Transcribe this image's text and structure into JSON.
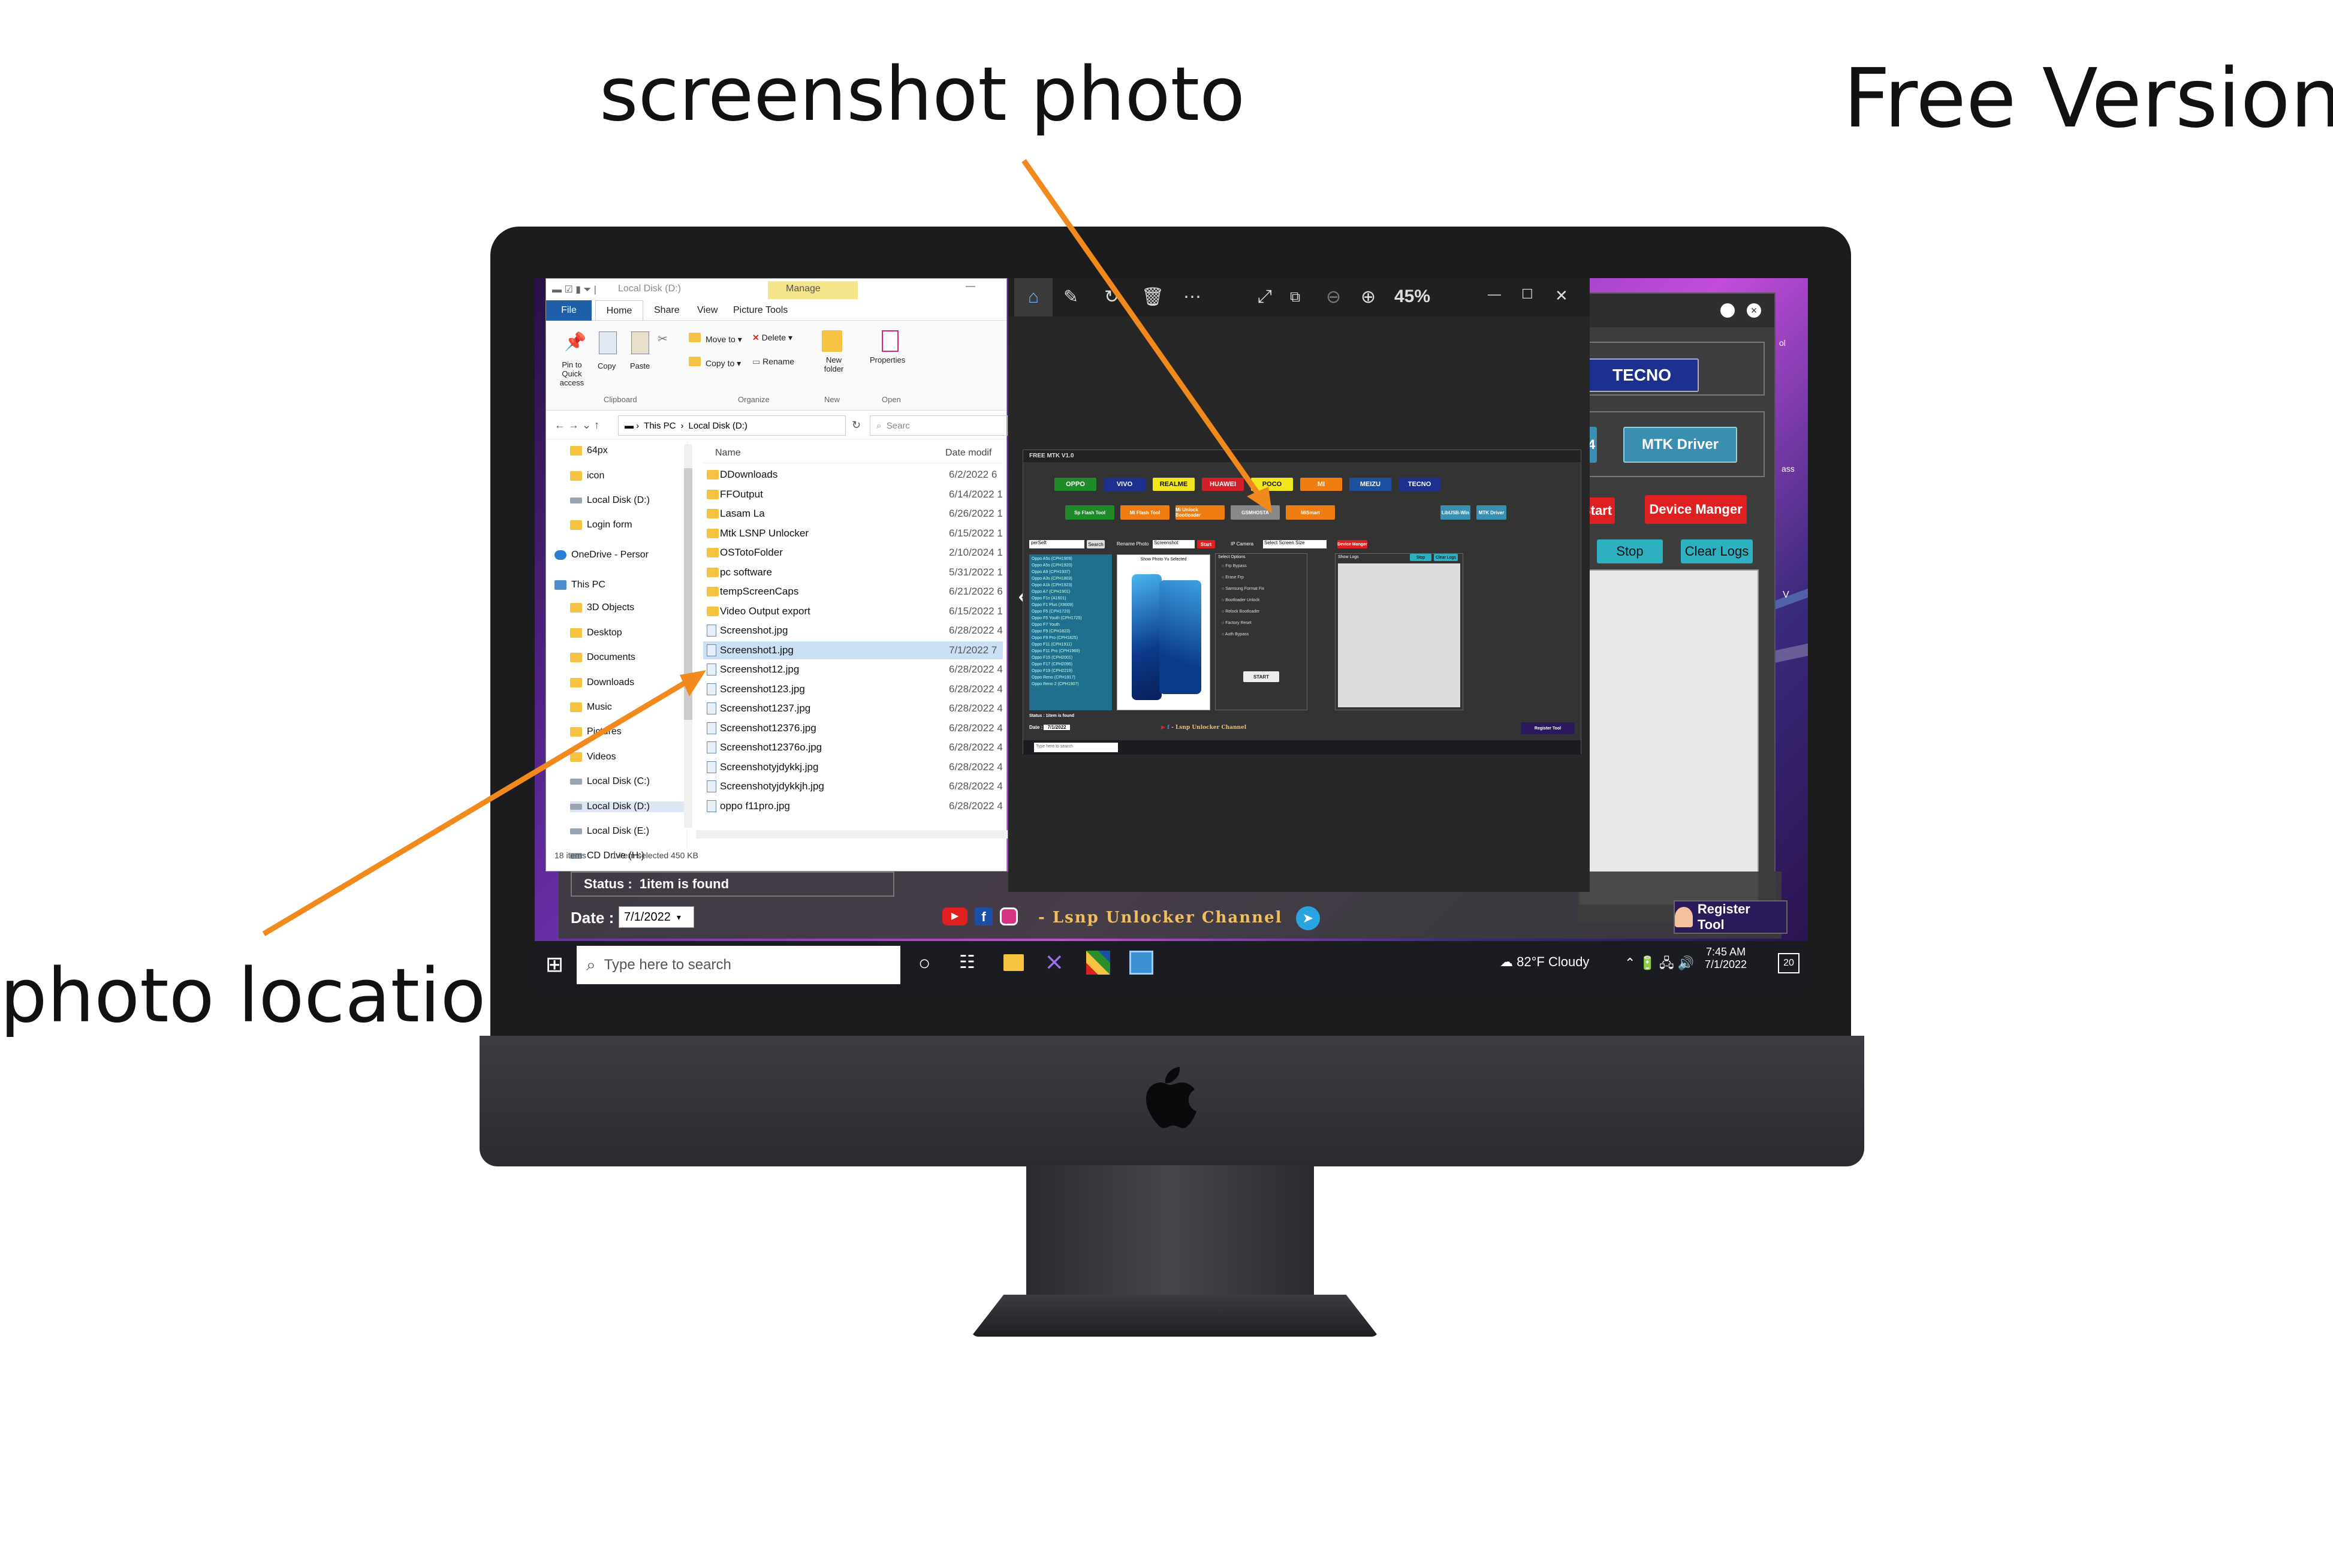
{
  "annotations": {
    "screenshot_photo": "screenshot photo",
    "free_version": "Free Version",
    "photo_location": "photo location"
  },
  "explorer": {
    "title": "Local Disk (D:)",
    "manage_tab": "Manage",
    "tabs": [
      "File",
      "Home",
      "Share",
      "View",
      "Picture Tools"
    ],
    "ribbon": {
      "pin": "Pin to Quick access",
      "copy": "Copy",
      "paste": "Paste",
      "move_to": "Move to",
      "copy_to": "Copy to",
      "delete": "Delete",
      "rename": "Rename",
      "new_folder": "New folder",
      "properties": "Properties",
      "group_clipboard": "Clipboard",
      "group_organize": "Organize",
      "group_new": "New",
      "group_open": "Open"
    },
    "breadcrumb": [
      "This PC",
      "Local Disk (D:)"
    ],
    "search_placeholder": "Searc",
    "col_name": "Name",
    "col_date": "Date modif",
    "nav": [
      {
        "label": "64px",
        "type": "folder"
      },
      {
        "label": "icon",
        "type": "folder"
      },
      {
        "label": "Local Disk (D:)",
        "type": "drive"
      },
      {
        "label": "Login form",
        "type": "folder"
      },
      {
        "label": "OneDrive - Persor",
        "type": "cloud"
      },
      {
        "label": "This PC",
        "type": "pc"
      },
      {
        "label": "3D Objects",
        "type": "folder"
      },
      {
        "label": "Desktop",
        "type": "folder"
      },
      {
        "label": "Documents",
        "type": "folder"
      },
      {
        "label": "Downloads",
        "type": "folder"
      },
      {
        "label": "Music",
        "type": "folder"
      },
      {
        "label": "Pictures",
        "type": "folder"
      },
      {
        "label": "Videos",
        "type": "folder"
      },
      {
        "label": "Local Disk (C:)",
        "type": "drive"
      },
      {
        "label": "Local Disk (D:)",
        "type": "drive"
      },
      {
        "label": "Local Disk (E:)",
        "type": "drive"
      },
      {
        "label": "CD Drive (H:)",
        "type": "drive"
      }
    ],
    "files": [
      {
        "name": "DDownloads",
        "date": "6/2/2022 6",
        "type": "folder"
      },
      {
        "name": "FFOutput",
        "date": "6/14/2022 1",
        "type": "folder"
      },
      {
        "name": "Lasam La",
        "date": "6/26/2022 1",
        "type": "folder"
      },
      {
        "name": "Mtk LSNP Unlocker",
        "date": "6/15/2022 1",
        "type": "folder"
      },
      {
        "name": "OSTotoFolder",
        "date": "2/10/2024 1",
        "type": "folder"
      },
      {
        "name": "pc software",
        "date": "5/31/2022 1",
        "type": "folder"
      },
      {
        "name": "tempScreenCaps",
        "date": "6/21/2022 6",
        "type": "folder"
      },
      {
        "name": "Video Output export",
        "date": "6/15/2022 1",
        "type": "folder"
      },
      {
        "name": "Screenshot.jpg",
        "date": "6/28/2022 4",
        "type": "image"
      },
      {
        "name": "Screenshot1.jpg",
        "date": "7/1/2022 7",
        "type": "image"
      },
      {
        "name": "Screenshot12.jpg",
        "date": "6/28/2022 4",
        "type": "image"
      },
      {
        "name": "Screenshot123.jpg",
        "date": "6/28/2022 4",
        "type": "image"
      },
      {
        "name": "Screenshot1237.jpg",
        "date": "6/28/2022 4",
        "type": "image"
      },
      {
        "name": "Screenshot12376.jpg",
        "date": "6/28/2022 4",
        "type": "image"
      },
      {
        "name": "Screenshot12376o.jpg",
        "date": "6/28/2022 4",
        "type": "image"
      },
      {
        "name": "Screenshotyjdykkj.jpg",
        "date": "6/28/2022 4",
        "type": "image"
      },
      {
        "name": "Screenshotyjdykkjh.jpg",
        "date": "6/28/2022 4",
        "type": "image"
      },
      {
        "name": "oppo f11pro.jpg",
        "date": "6/28/2022 4",
        "type": "image"
      }
    ],
    "selected_index": 9,
    "status_items": "18 items",
    "status_selected": "1 item selected  450 KB"
  },
  "photos": {
    "zoom": "45%"
  },
  "inner_tool": {
    "title": "FREE MTK V1.0",
    "brands": [
      {
        "label": "OPPO",
        "color": "#1f8a2a",
        "text": "#ffffff"
      },
      {
        "label": "VIVO",
        "color": "#1d2f8f",
        "text": "#ffffff"
      },
      {
        "label": "REALME",
        "color": "#f2e61c",
        "text": "#111111"
      },
      {
        "label": "HUAWEI",
        "color": "#d41f2a",
        "text": "#ffffff"
      },
      {
        "label": "POCO",
        "color": "#f2e61c",
        "text": "#111111"
      },
      {
        "label": "MI",
        "color": "#f07d12",
        "text": "#ffffff"
      },
      {
        "label": "MEIZU",
        "color": "#1d4fa0",
        "text": "#ffffff"
      },
      {
        "label": "TECNO",
        "color": "#1d2f8f",
        "text": "#ffffff"
      }
    ],
    "tools": [
      {
        "label": "Sp Flash Tool",
        "color": "#1f8a2a"
      },
      {
        "label": "Mi Flash Tool",
        "color": "#f07d12"
      },
      {
        "label": "Mi Unlock Bootloader",
        "color": "#f07d12"
      },
      {
        "label": "GSMHOSTA",
        "color": "#888888"
      },
      {
        "label": "MiSmart",
        "color": "#f07d12"
      }
    ],
    "drivers": [
      "LibUSB-Win",
      "MTK Driver"
    ],
    "search_value": "perSeft",
    "search_btn": "Search",
    "rename_label": "Rename Photo",
    "rename_value": "Screenshot",
    "start_btn": "Start",
    "camera_label": "IP Camera",
    "camera_value": "Select Screen Size",
    "device_btn": "Device Manger",
    "model_list": [
      "Oppo A5s (CPH1909)",
      "Oppo A5s (CPH1920)",
      "Oppo A9 (CPH1937)",
      "Oppo A3s (CPH1803)",
      "Oppo A1k (CPH1923)",
      "Oppo A7 (CPH1901)",
      "Oppo F1s (A1601)",
      "Oppo F1 Plus (X9009)",
      "Oppo F5 (CPH1723)",
      "Oppo F5 Youth (CPH1725)",
      "Oppo F7 Youth",
      "Oppo F9 (CPH1823)",
      "Oppo F9 Pro (CPH1825)",
      "Oppo F11 (CPH1911)",
      "Oppo F11 Pro (CPH1969)",
      "Oppo F15 (CPH2001)",
      "Oppo F17 (CPH2095)",
      "Oppo F19 (CPH2219)",
      "Oppo Reno (CPH1917)",
      "Oppo Reno 2 (CPH1907)"
    ],
    "preview_label": "Show Photo Yu Selected",
    "options_title": "Select Options",
    "options": [
      "Frp Bypass",
      "Erase Frp",
      "Samsung Format Fix",
      "Bootloader Unlock",
      "Relock Bootloader",
      "Factory Reset",
      "Auth Bypass"
    ],
    "start_bottom": "START",
    "logs_title": "Show Logs",
    "stop": "Stop",
    "clear": "Clear Logs",
    "status_label": "Status :",
    "status_value": "1item is found",
    "date_label": "Date :",
    "date_value": "7/1/2022",
    "channel": "Lsnp Unlocker Channel",
    "register": "Register Tool"
  },
  "bg_tool": {
    "tecno": "TECNO",
    "mtk_driver": "MTK Driver",
    "start": "Start",
    "device_manger": "Device Manger",
    "stop": "Stop",
    "clear_logs": "Clear Logs",
    "status_label": "Status :",
    "status_value": "1item is found",
    "date_label": "Date :",
    "date_value": "7/1/2022",
    "channel": "- Lsnp Unlocker Channel",
    "register": "Register Tool",
    "edge_fragments": [
      "ol",
      "ass",
      "V"
    ]
  },
  "taskbar": {
    "search_placeholder": "Type here to search",
    "weather": "82°F  Cloudy",
    "time": "7:45 AM",
    "date": "7/1/2022",
    "notifications": "20"
  },
  "colors": {
    "arrow": "#f2891d",
    "brand_green": "#1f8a2a",
    "tecno_blue": "#1d2f8f"
  }
}
